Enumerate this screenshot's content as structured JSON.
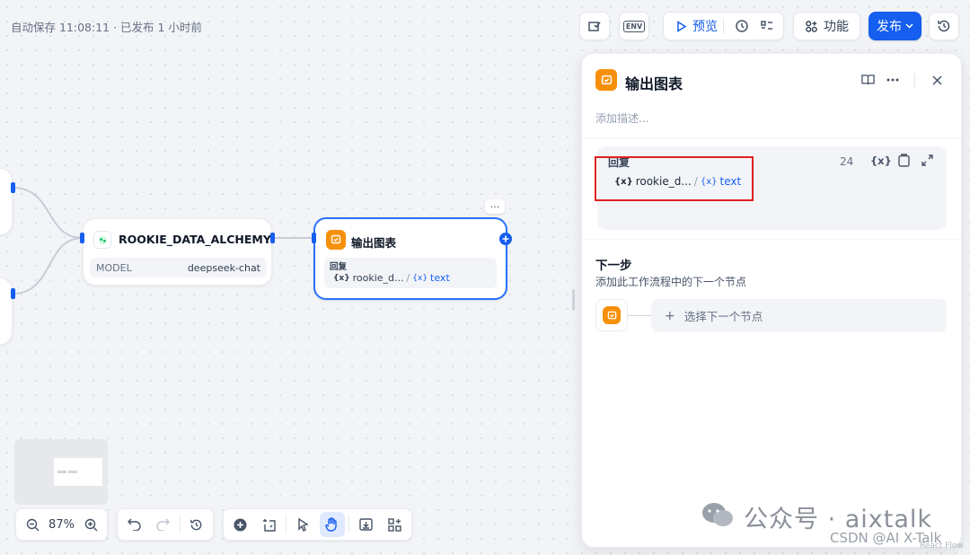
{
  "status": {
    "autosave": "自动保存 11:08:11 · 已发布 1 小时前"
  },
  "toolbar": {
    "env_label": "ENV",
    "preview_label": "预览",
    "features_label": "功能",
    "publish_label": "发布"
  },
  "canvas": {
    "llm_node": {
      "title": "ROOKIE_DATA_ALCHEMY",
      "model_key": "MODEL",
      "model_value": "deepseek-chat"
    },
    "answer_node": {
      "title": "输出图表",
      "answer_label": "回复",
      "var_node": "rookie_d...",
      "var_sep": "/",
      "var_name": "text",
      "more": "···"
    }
  },
  "panel": {
    "title": "输出图表",
    "desc_placeholder": "添加描述...",
    "answer_label": "回复",
    "char_count": "24",
    "var_node": "rookie_d...",
    "var_sep": "/",
    "var_name": "text",
    "var_symbol": "{x}",
    "next_title": "下一步",
    "next_desc": "添加此工作流程中的下一个节点",
    "select_next": "选择下一个节点"
  },
  "bottom": {
    "zoom": "87%"
  },
  "watermark": {
    "main": "公众号 · aixtalk",
    "csdn": "CSDN @AI X-Talk",
    "reactflow": "React Flow"
  },
  "colors": {
    "accent": "#155eef",
    "answer_icon": "#f79009",
    "highlight": "#e02020"
  }
}
